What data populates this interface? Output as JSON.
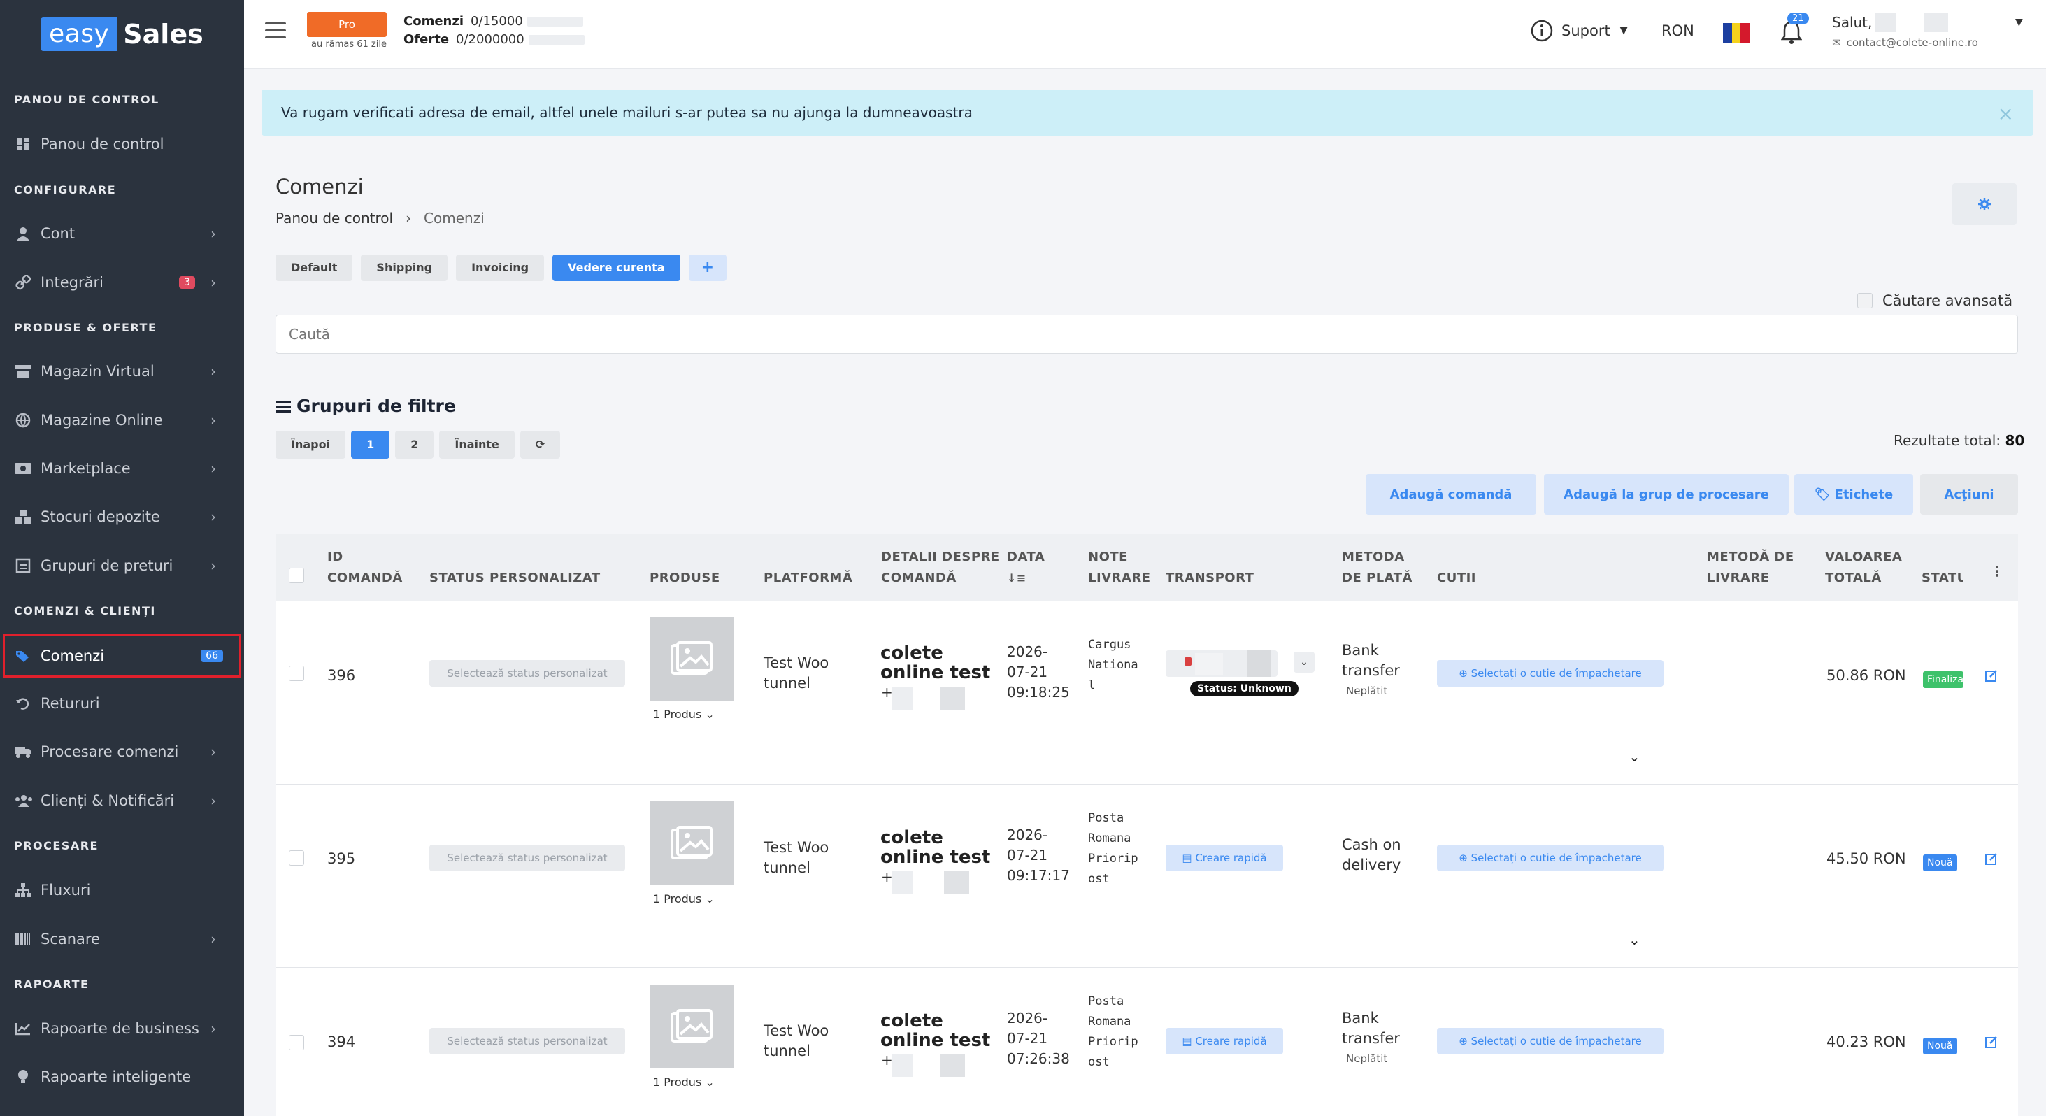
{
  "logo": {
    "easy": "easy",
    "sales": "Sales"
  },
  "sidebar": {
    "sections": [
      {
        "label": "PANOU DE CONTROL"
      },
      {
        "label": "CONFIGURARE"
      },
      {
        "label": "PRODUSE & OFERTE"
      },
      {
        "label": "COMENZI & CLIENȚI"
      },
      {
        "label": "PROCESARE"
      },
      {
        "label": "RAPOARTE"
      }
    ],
    "items": [
      {
        "label": "Panou de control",
        "icon": "dashboard-icon"
      },
      {
        "label": "Cont",
        "icon": "user-icon"
      },
      {
        "label": "Integrări",
        "icon": "link-icon",
        "badge": "3"
      },
      {
        "label": "Magazin Virtual",
        "icon": "store-icon"
      },
      {
        "label": "Magazine Online",
        "icon": "globe-icon"
      },
      {
        "label": "Marketplace",
        "icon": "marketplace-icon"
      },
      {
        "label": "Stocuri depozite",
        "icon": "boxes-icon"
      },
      {
        "label": "Grupuri de preturi",
        "icon": "price-group-icon"
      },
      {
        "label": "Comenzi",
        "icon": "tags-icon",
        "badge": "66"
      },
      {
        "label": "Retururi",
        "icon": "undo-icon"
      },
      {
        "label": "Procesare comenzi",
        "icon": "truck-icon"
      },
      {
        "label": "Clienți & Notificări",
        "icon": "users-icon"
      },
      {
        "label": "Fluxuri",
        "icon": "sitemap-icon"
      },
      {
        "label": "Scanare",
        "icon": "barcode-icon"
      },
      {
        "label": "Rapoarte de business",
        "icon": "chart-icon"
      },
      {
        "label": "Rapoarte inteligente",
        "icon": "bulb-icon"
      }
    ]
  },
  "topbar": {
    "plan": "Pro",
    "plan_remaining": "au rămas 61 zile",
    "orders_label": "Comenzi",
    "orders_value": "0/15000",
    "offers_label": "Oferte",
    "offers_value": "0/2000000",
    "support": "Suport",
    "currency": "RON",
    "notifications": "21",
    "hello": "Salut,",
    "email": "contact@colete-online.ro"
  },
  "alert": {
    "text": "Va rugam verificati adresa de email, altfel unele mailuri s-ar putea sa nu ajunga la dumneavoastra",
    "close": "×"
  },
  "page": {
    "title": "Comenzi",
    "breadcrumb_home": "Panou de control",
    "breadcrumb_current": "Comenzi"
  },
  "view_tabs": [
    "Default",
    "Shipping",
    "Invoicing",
    "Vedere curenta",
    "+"
  ],
  "advanced_search": "Căutare avansată",
  "search": {
    "placeholder": "Caută"
  },
  "filters_title": "Grupuri de filtre",
  "pager": {
    "prev": "Înapoi",
    "pages": [
      "1",
      "2"
    ],
    "next": "Înainte",
    "current": "1"
  },
  "total": {
    "label": "Rezultate total:",
    "value": "80"
  },
  "actions": {
    "add_order": "Adaugă comandă",
    "add_group": "Adaugă la grup de procesare",
    "labels": "Etichete",
    "actions": "Acțiuni"
  },
  "table": {
    "headers": {
      "id": [
        "ID",
        "COMANDĂ"
      ],
      "status": "STATUS PERSONALIZAT",
      "products": "PRODUSE",
      "platform": "PLATFORMĂ",
      "details": [
        "DETALII DESPRE",
        "COMANDĂ"
      ],
      "date": "DATA",
      "notes": [
        "NOTE",
        "LIVRARE"
      ],
      "transport": "TRANSPORT",
      "payment": [
        "METODA",
        "DE PLATĂ"
      ],
      "boxes": "CUTII",
      "delivery": [
        "METODĂ DE",
        "LIVRARE"
      ],
      "total": [
        "VALOAREA",
        "TOTALĂ"
      ],
      "state": "STATU"
    },
    "status_placeholder": "Selectează status personalizat",
    "product_count": "1 Produs",
    "box_placeholder": "Selectați o cutie de împachetare",
    "quick_create": "Creare rapidă",
    "rows": [
      {
        "id": "396",
        "platform": [
          "Test Woo",
          "tunnel"
        ],
        "customer": [
          "colete",
          "online test"
        ],
        "phone_prefix": "+",
        "date": [
          "2026-",
          "07-21",
          "09:18:25"
        ],
        "notes": [
          "Cargus",
          "Nationa",
          "l"
        ],
        "transport_status": "Status: Unknown",
        "payment": [
          "Bank",
          "transfer"
        ],
        "payment_status": "Neplătit",
        "total": "50.86 RON",
        "state": "Finalizată",
        "state_color": "#3ec26b"
      },
      {
        "id": "395",
        "platform": [
          "Test Woo",
          "tunnel"
        ],
        "customer": [
          "colete",
          "online test"
        ],
        "phone_prefix": "+",
        "date": [
          "2026-",
          "07-21",
          "09:17:17"
        ],
        "notes": [
          "Posta",
          "Romana",
          "Priorip",
          "ost"
        ],
        "payment": [
          "Cash on",
          "delivery"
        ],
        "payment_status": "",
        "total": "45.50 RON",
        "state": "Nouă",
        "state_color": "#3a89f0"
      },
      {
        "id": "394",
        "platform": [
          "Test Woo",
          "tunnel"
        ],
        "customer": [
          "colete",
          "online test"
        ],
        "phone_prefix": "+",
        "date": [
          "2026-",
          "07-21",
          "07:26:38"
        ],
        "notes": [
          "Posta",
          "Romana",
          "Priorip",
          "ost"
        ],
        "payment": [
          "Bank",
          "transfer"
        ],
        "payment_status": "Neplătit",
        "total": "40.23 RON",
        "state": "Nouă",
        "state_color": "#3a89f0"
      }
    ]
  },
  "colors": {
    "sidebar_bg": "#2b333e",
    "accent": "#3a89f0",
    "pro": "#f06b27",
    "alert_bg": "#cdeff8",
    "active_outline": "#e0202c"
  }
}
